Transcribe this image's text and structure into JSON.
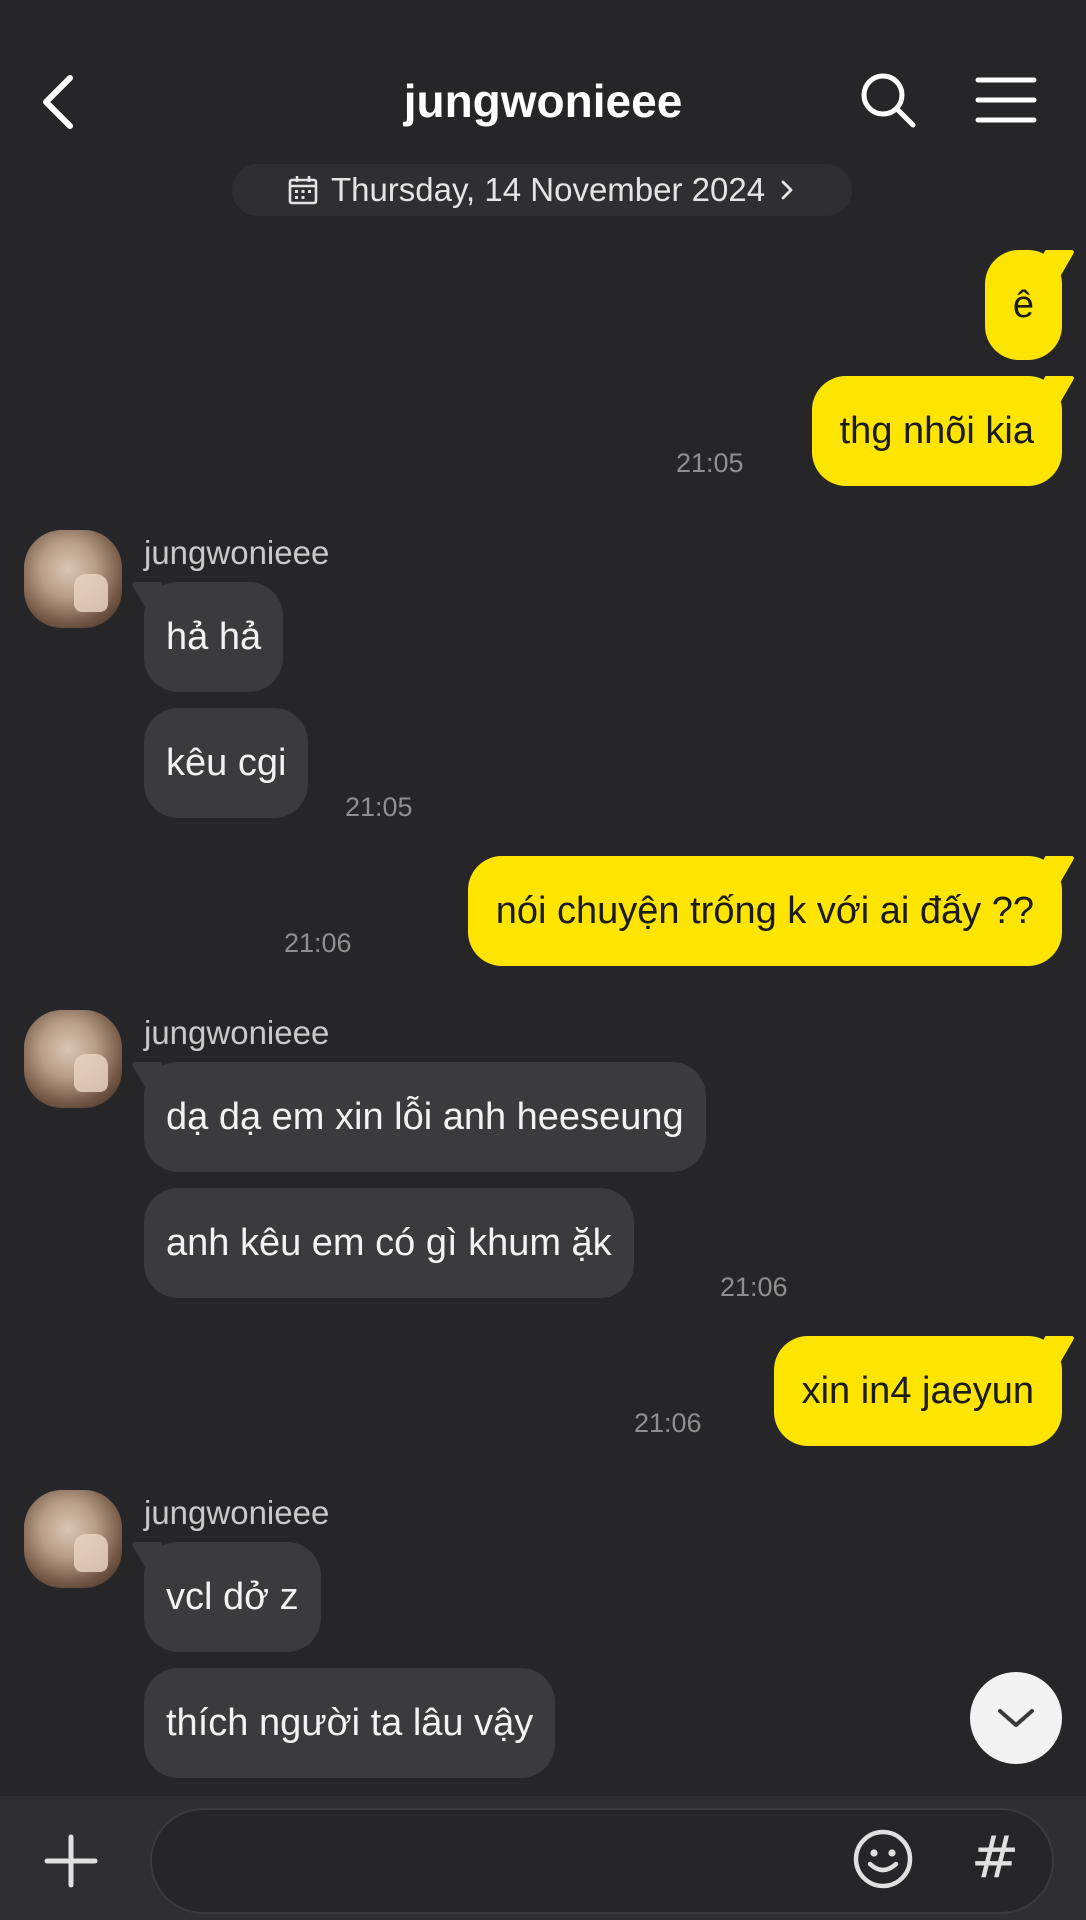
{
  "header": {
    "title": "jungwonieee",
    "date_label": "Thursday, 14 November 2024"
  },
  "messages": [
    {
      "from": "me",
      "text": "ê"
    },
    {
      "from": "me",
      "text": "thg nhõi kia",
      "time": "21:05"
    },
    {
      "from": "jungwonieee",
      "sender": "jungwonieee",
      "text": "hả hả"
    },
    {
      "from": "jungwonieee",
      "text": "kêu cgi",
      "time": "21:05"
    },
    {
      "from": "me",
      "text": "nói chuyện trống k với ai đấy ??",
      "time": "21:06"
    },
    {
      "from": "jungwonieee",
      "sender": "jungwonieee",
      "text": "dạ dạ em xin lỗi anh heeseung"
    },
    {
      "from": "jungwonieee",
      "text": "anh kêu em có gì khum ặk",
      "time": "21:06"
    },
    {
      "from": "me",
      "text": "xin in4 jaeyun",
      "time": "21:06"
    },
    {
      "from": "jungwonieee",
      "sender": "jungwonieee",
      "text": "vcl dở z"
    },
    {
      "from": "jungwonieee",
      "text": "thích người ta lâu vậy"
    }
  ],
  "input": {
    "value": "",
    "placeholder": ""
  },
  "icons": {
    "back": "chevron-left-icon",
    "search": "search-icon",
    "menu": "hamburger-menu-icon",
    "calendar": "calendar-icon",
    "date_chevron": "chevron-right-icon",
    "scroll_down": "chevron-down-icon",
    "plus": "plus-icon",
    "emoji": "emoji-icon",
    "hashtag": "#"
  },
  "colors": {
    "background": "#262628",
    "my_bubble": "#fee500",
    "their_bubble": "#3b3b3d",
    "timestamp": "#8f8f8f"
  }
}
